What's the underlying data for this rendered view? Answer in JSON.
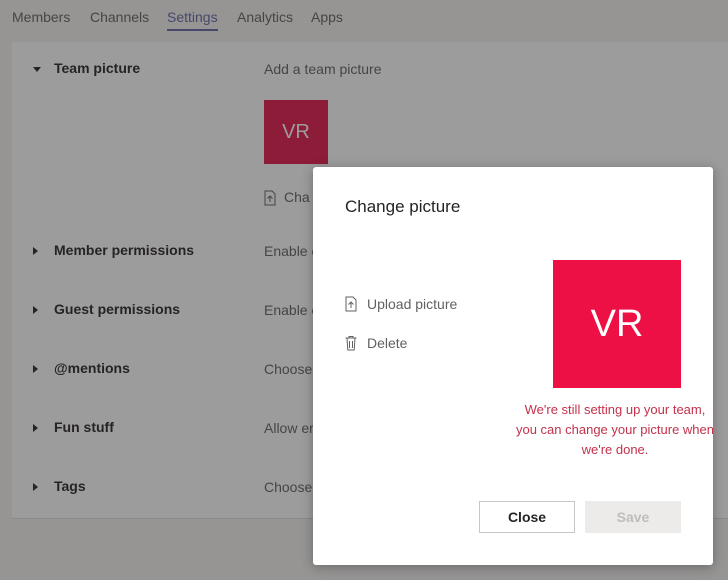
{
  "tabs": [
    {
      "label": "Members",
      "active": false
    },
    {
      "label": "Channels",
      "active": false
    },
    {
      "label": "Settings",
      "active": true
    },
    {
      "label": "Analytics",
      "active": false
    },
    {
      "label": "Apps",
      "active": false
    }
  ],
  "settings": {
    "sections": [
      {
        "title": "Team picture",
        "description": "Add a team picture",
        "expanded": true
      },
      {
        "title": "Member permissions",
        "description": "Enable c",
        "expanded": false
      },
      {
        "title": "Guest permissions",
        "description": "Enable c",
        "expanded": false
      },
      {
        "title": "@mentions",
        "description": "Choose",
        "expanded": false
      },
      {
        "title": "Fun stuff",
        "description": "Allow em",
        "expanded": false
      },
      {
        "title": "Tags",
        "description": "Choose",
        "expanded": false
      }
    ],
    "team_picture": {
      "initials": "VR",
      "change_label": "Cha",
      "color": "#e2164a"
    }
  },
  "dialog": {
    "title": "Change picture",
    "upload_label": "Upload picture",
    "delete_label": "Delete",
    "avatar_initials": "VR",
    "avatar_color": "#ed1045",
    "warning": "We're still setting up your team,\nyou can change your picture when\nwe're done.",
    "close_label": "Close",
    "save_label": "Save"
  },
  "colors": {
    "accent": "#6264a7",
    "warning": "#c4314b"
  }
}
